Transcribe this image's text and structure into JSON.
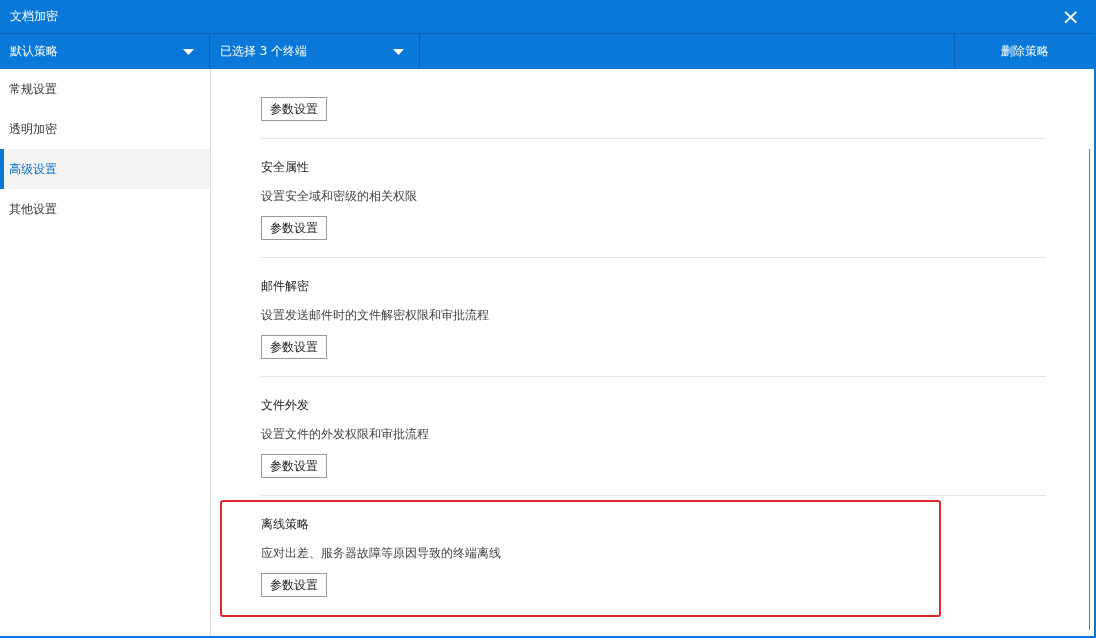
{
  "window": {
    "title": "文档加密",
    "close": "×"
  },
  "toolbar": {
    "policy": {
      "value": "默认策略"
    },
    "terminals": {
      "value": "已选择 3 个终端"
    },
    "delete_button": "删除策略"
  },
  "sidebar": {
    "items": [
      {
        "label": "常规设置",
        "selected": false
      },
      {
        "label": "透明加密",
        "selected": false
      },
      {
        "label": "高级设置",
        "selected": true
      },
      {
        "label": "其他设置",
        "selected": false
      }
    ]
  },
  "sections": [
    {
      "button": "参数设置",
      "highlighted": false
    },
    {
      "title": "安全属性",
      "description": "设置安全域和密级的相关权限",
      "button": "参数设置",
      "highlighted": false
    },
    {
      "title": "邮件解密",
      "description": "设置发送邮件时的文件解密权限和审批流程",
      "button": "参数设置",
      "highlighted": false
    },
    {
      "title": "文件外发",
      "description": "设置文件的外发权限和审批流程",
      "button": "参数设置",
      "highlighted": false
    },
    {
      "title": "离线策略",
      "description": "应对出差、服务器故障等原因导致的终端离线",
      "button": "参数设置",
      "highlighted": true
    }
  ]
}
